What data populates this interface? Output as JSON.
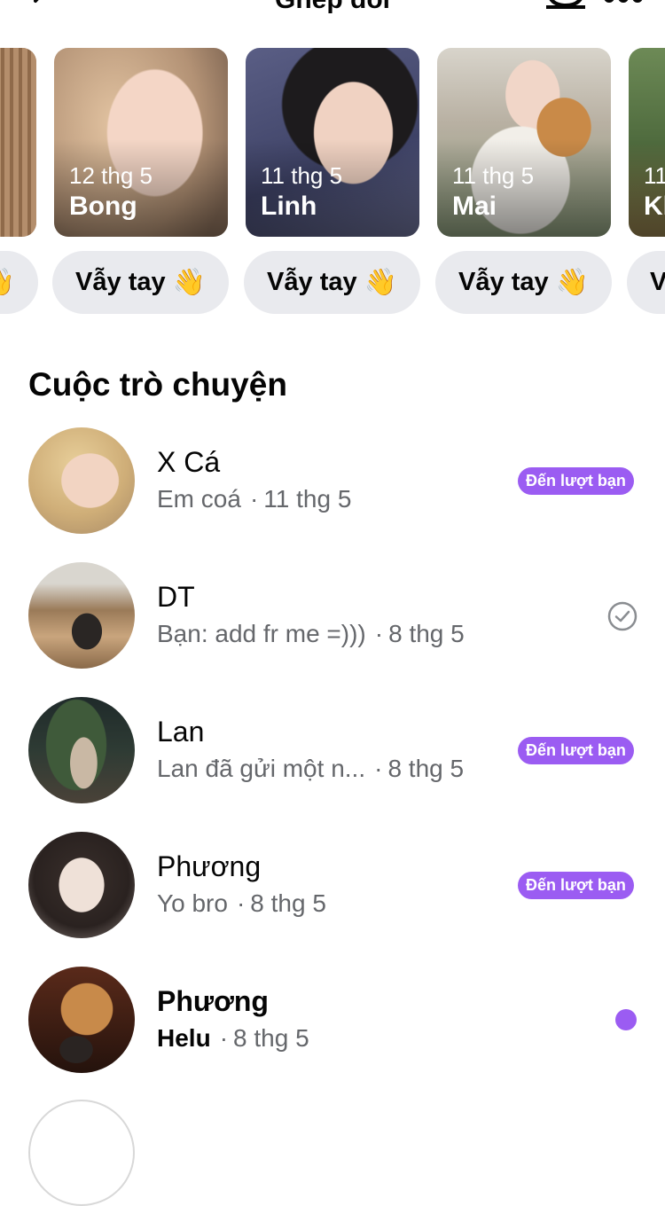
{
  "header": {
    "title": "Ghép đôi",
    "back_icon": "chevron-left-icon",
    "camera_icon": "video-camera-icon",
    "more_icon": "more-dots-icon"
  },
  "matches": [
    {
      "date": "",
      "name": ""
    },
    {
      "date": "12 thg 5",
      "name": "Bong"
    },
    {
      "date": "11 thg 5",
      "name": "Linh"
    },
    {
      "date": "11 thg 5",
      "name": "Mai"
    },
    {
      "date": "11",
      "name": "Kl"
    }
  ],
  "wave": {
    "label": "Vẫy tay",
    "emoji": "👋",
    "partial_right": "V"
  },
  "conversations_title": "Cuộc trò chuyện",
  "conversations": [
    {
      "name": "X Cá",
      "message": "Em coá",
      "separator": "·",
      "time": "11 thg 5",
      "badge": "Đến lượt bạn",
      "status": "your-turn"
    },
    {
      "name": "DT",
      "message": "Bạn: add fr me =)))",
      "separator": "·",
      "time": "8 thg 5",
      "status": "sent-check"
    },
    {
      "name": "Lan",
      "message": "Lan đã gửi một n...",
      "separator": "·",
      "time": "8 thg 5",
      "badge": "Đến lượt bạn",
      "status": "your-turn"
    },
    {
      "name": "Phương",
      "message": "Yo bro",
      "separator": "·",
      "time": "8 thg 5",
      "badge": "Đến lượt bạn",
      "status": "your-turn"
    },
    {
      "name": "Phương",
      "message": "Helu",
      "separator": "·",
      "time": "8 thg 5",
      "status": "unread"
    }
  ],
  "colors": {
    "accent": "#9b5cf2",
    "chip_bg": "#e9eaee",
    "secondary_text": "#65676b"
  }
}
